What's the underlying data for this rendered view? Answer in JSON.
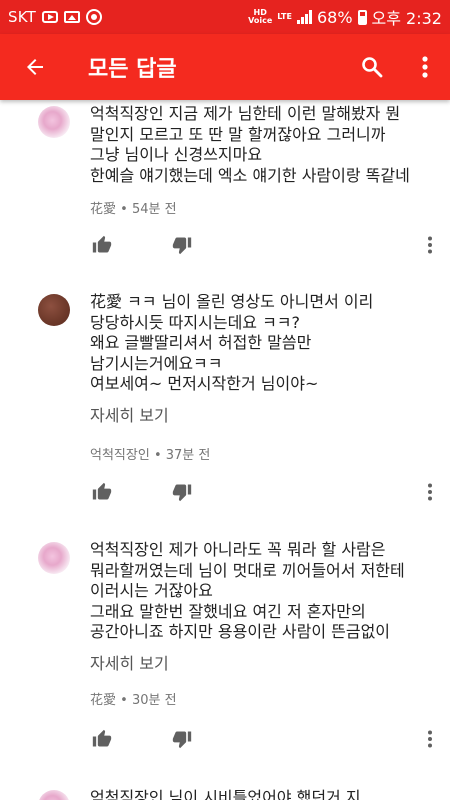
{
  "status_bar": {
    "carrier": "SKT",
    "hd_voice_top": "HD",
    "hd_voice_bottom": "Voice",
    "lte": "LTE",
    "battery": "68%",
    "time": "오후 2:32"
  },
  "app_bar": {
    "title": "모든 답글"
  },
  "comments": [
    {
      "text": "억척직장인 지금 제가 님한테 이런 말해봤자 뭔\n말인지 모르고 또 딴 말 할꺼잖아요 그러니까\n그냥 님이나 신경쓰지마요\n한예슬 얘기했는데 엑소 얘기한 사람이랑 똑같네",
      "author": "花愛",
      "time": "54분 전"
    },
    {
      "text": "花愛 ㅋㅋ 님이 올린 영상도 아니면서 이리\n당당하시듯 따지시는데요 ㅋㅋ?\n왜요 글빨딸리셔서 허접한 말씀만\n남기시는거에요ㅋㅋ\n여보세여~ 먼저시작한거 님이야~",
      "more": "자세히 보기",
      "author": "억척직장인",
      "time": "37분 전"
    },
    {
      "text": "억척직장인 제가 아니라도 꼭 뭐라 할 사람은\n뭐라할꺼였는데 님이 멋대로 끼어들어서 저한테\n이러시는 거잖아요\n그래요 말한번 잘했네요 여긴 저 혼자만의\n공간아니죠 하지만 용용이란 사람이 뜬금없이",
      "more": "자세히 보기",
      "author": "花愛",
      "time": "30분 전"
    },
    {
      "text": "억척직장인 님이 시비틀었어야 했던거 지"
    }
  ],
  "meta_separator": "•"
}
